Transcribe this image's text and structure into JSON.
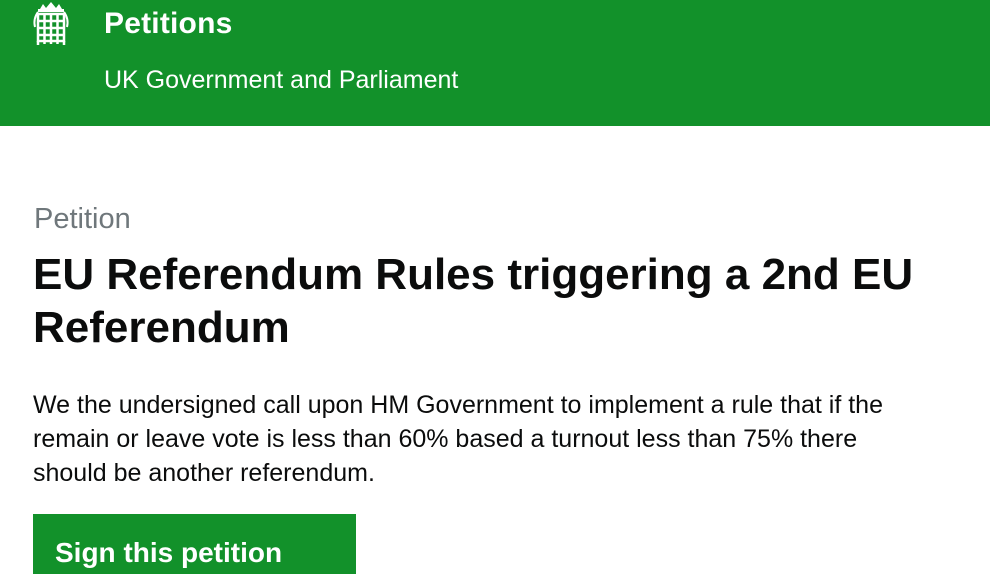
{
  "header": {
    "logo_icon": "portcullis-icon",
    "title": "Petitions",
    "subtitle": "UK Government and Parliament",
    "background_color": "#12912a",
    "text_color": "#ffffff"
  },
  "petition": {
    "caption": "Petition",
    "title": "EU Referendum Rules triggering a 2nd EU Referendum",
    "description": "We the undersigned call upon HM Government to implement a rule that if the remain or leave vote is less than 60% based a turnout less than 75% there should be another referendum."
  },
  "actions": {
    "sign_label": "Sign this petition",
    "button_color": "#12912a"
  }
}
